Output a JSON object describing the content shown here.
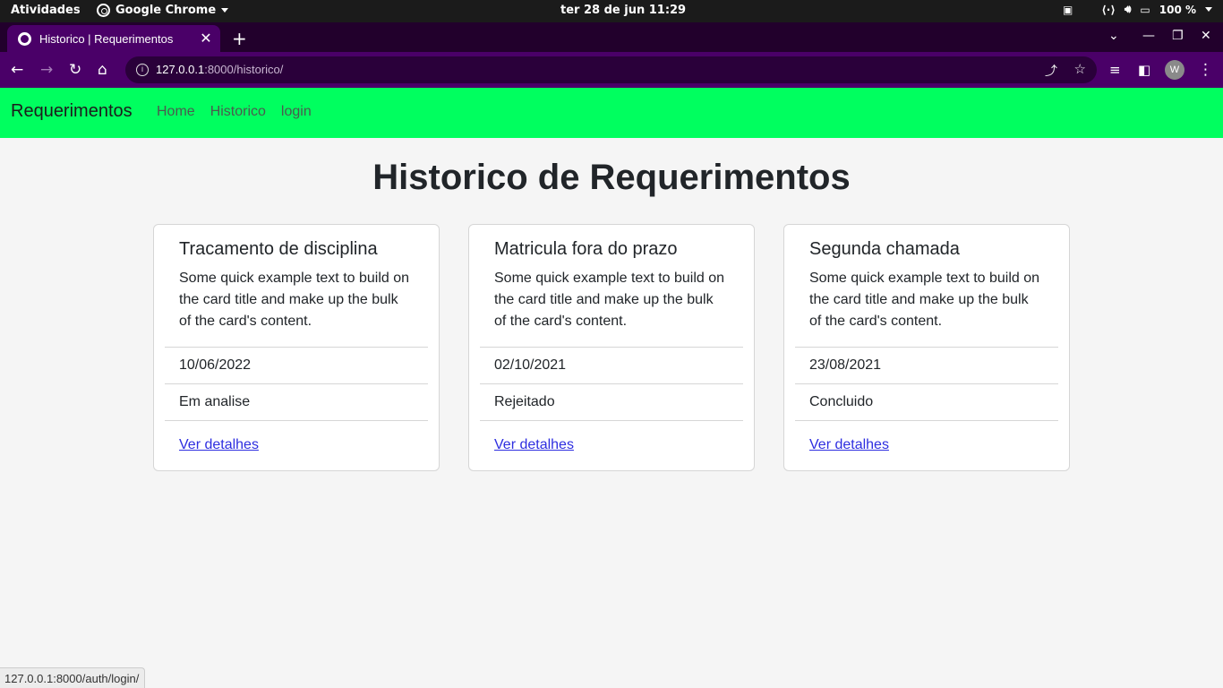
{
  "system_bar": {
    "activities": "Atividades",
    "app_name": "Google Chrome",
    "clock": "ter 28 de jun  11:29",
    "battery": "100 %"
  },
  "browser": {
    "tab_title": "Historico | Requerimentos",
    "url_host": "127.0.0.1",
    "url_rest": ":8000/historico/",
    "avatar_letter": "W",
    "status_url": "127.0.0.1:8000/auth/login/"
  },
  "site": {
    "brand": "Requerimentos",
    "nav": [
      "Home",
      "Historico",
      "login"
    ],
    "page_title": "Historico de Requerimentos",
    "cards": [
      {
        "title": "Tracamento de disciplina",
        "text": "Some quick example text to build on the card title and make up the bulk of the card's content.",
        "date": "10/06/2022",
        "status": "Em analise",
        "link": "Ver detalhes"
      },
      {
        "title": "Matricula fora do prazo",
        "text": "Some quick example text to build on the card title and make up the bulk of the card's content.",
        "date": "02/10/2021",
        "status": "Rejeitado",
        "link": "Ver detalhes"
      },
      {
        "title": "Segunda chamada",
        "text": "Some quick example text to build on the card title and make up the bulk of the card's content.",
        "date": "23/08/2021",
        "status": "Concluido",
        "link": "Ver detalhes"
      }
    ]
  },
  "colors": {
    "navbar_bg": "#00ff5f",
    "browser_frame": "#4a0068",
    "link": "#2e2ee0"
  }
}
